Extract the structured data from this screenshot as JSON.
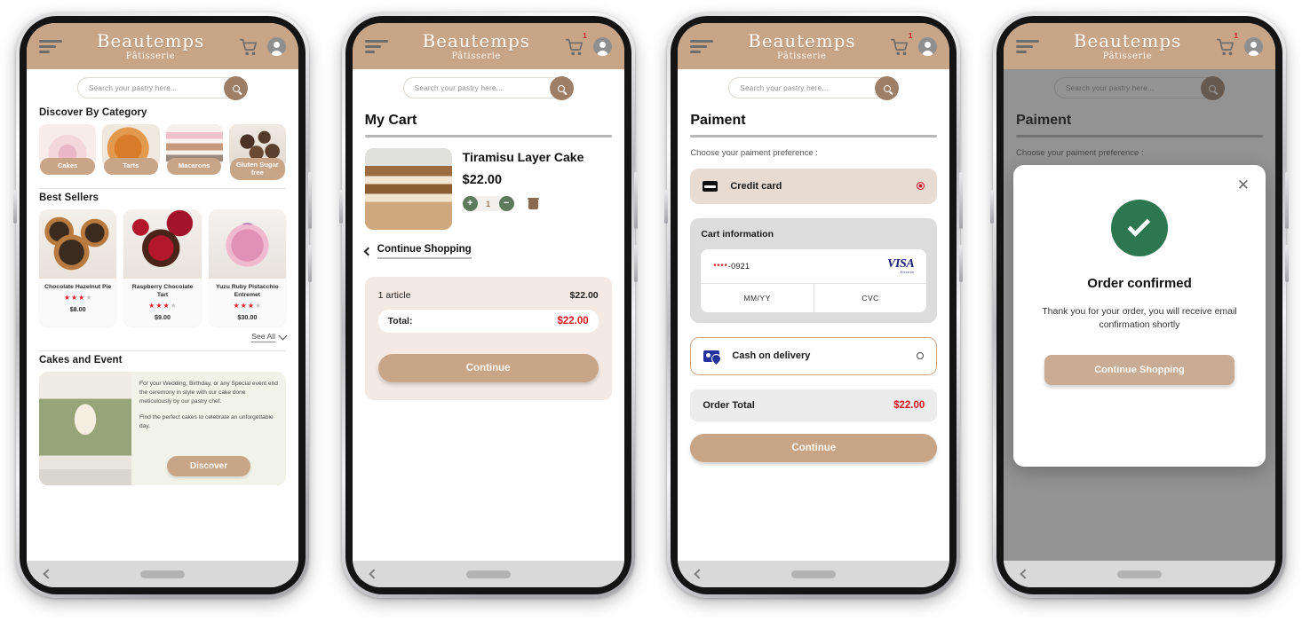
{
  "app": {
    "brand_name": "Beautemps",
    "brand_sub": "Pâtisserie",
    "cart_badge": "1",
    "accent": "#c9a588",
    "price_red": "#d8121f",
    "success_green": "#237a4d"
  },
  "search": {
    "placeholder": "Search your pastry here..."
  },
  "home": {
    "category_section_title": "Discover By Category",
    "categories": [
      {
        "label": "Cakes",
        "art": "img-cake1"
      },
      {
        "label": "Tarts",
        "art": "img-tart"
      },
      {
        "label": "Macarons",
        "art": "img-maca"
      },
      {
        "label": "Gluten Sugar free",
        "art": "img-truf"
      }
    ],
    "best_sellers_title": "Best Sellers",
    "best_sellers": [
      {
        "name": "Chocolate Hazelnut Pie",
        "rating": 3,
        "max_rating": 4,
        "price": "$8.00",
        "art": "img-haz"
      },
      {
        "name": "Raspberry Chocolate Tart",
        "rating": 3,
        "max_rating": 4,
        "price": "$9.00",
        "art": "img-rasp"
      },
      {
        "name": "Yuzu Ruby Pistacchio Entremet",
        "rating": 3,
        "max_rating": 4,
        "price": "$30.00",
        "art": "img-yuzu"
      }
    ],
    "see_all_label": "See All",
    "events_title": "Cakes and Event",
    "promo": {
      "paragraph1": "For your Wedding, Birthday, or any Special event end the ceremony in style with our cake done meticulously by our pastry chef.",
      "paragraph2": "Find the perfect cakes to celebrate an unforgettable day.",
      "button_label": "Discover"
    }
  },
  "cart": {
    "title": "My Cart",
    "item": {
      "name": "Tiramisu Layer Cake",
      "price": "$22.00",
      "quantity": "1",
      "increase_label": "+",
      "decrease_label": "−"
    },
    "continue_shopping_label": "Continue Shopping",
    "summary": {
      "articles_label": "1 article",
      "articles_amount": "$22.00",
      "total_label": "Total:",
      "total_amount": "$22.00"
    },
    "continue_label": "Continue"
  },
  "payment": {
    "title": "Paiment",
    "subtitle": "Choose your paiment preference :",
    "option_credit_card": "Credit card",
    "option_cash": "Cash on delivery",
    "card_info_title": "Cart information",
    "card_masked_stars": "****",
    "card_masked_last4": "-0921",
    "card_brand_name": "VISA",
    "card_brand_sub": "Electron",
    "expiry_placeholder": "MM/YY",
    "cvc_placeholder": "CVC",
    "order_total_label": "Order Total",
    "order_total_amount": "$22.00",
    "continue_label": "Continue"
  },
  "confirmation": {
    "close_label": "✕",
    "title": "Order confirmed",
    "message": "Thank you for your order, you will receive email confirmation shortly",
    "button_label": "Continue Shopping"
  }
}
